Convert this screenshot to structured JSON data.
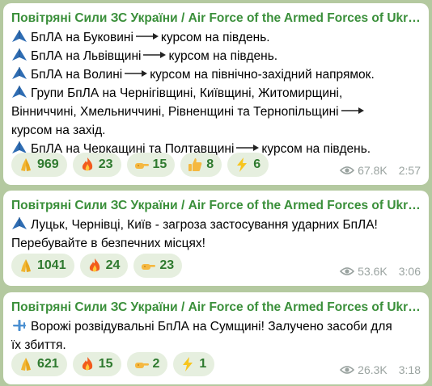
{
  "colors": {
    "sender": "#3a8f3a",
    "reaction_bg": "#e6efdf",
    "reaction_text": "#2f7a2f",
    "meta": "#9aa3a0",
    "chat_bg": "#b4c9a0"
  },
  "messages": [
    {
      "sender": "Повітряні Сили ЗС України / Air Force of the Armed Forces of Ukraine",
      "lines": [
        {
          "icon": "drone-icon",
          "text": "БпЛА на Буковині",
          "arrow": true,
          "text2": "курсом на південь."
        },
        {
          "icon": "drone-icon",
          "text": "БпЛА на Львівщині",
          "arrow": true,
          "text2": "курсом на південь."
        },
        {
          "icon": "drone-icon",
          "text": "БпЛА на Волині",
          "arrow": true,
          "text2": "курсом на північно-західний напрямок."
        },
        {
          "icon": "drone-icon",
          "text": "Групи БпЛА на Чернігівщині, Київщині, Житомирщині,"
        },
        {
          "icon": "",
          "text": "Вінниччині, Хмельниччині, Рівненщині та Тернопільщині",
          "arrow": true
        },
        {
          "icon": "",
          "text": "курсом на захід."
        },
        {
          "icon": "drone-icon",
          "text": "БпЛА на Черкащині та Полтавщині",
          "arrow": true,
          "text2": "курсом на південь."
        }
      ],
      "reactions": [
        {
          "icon": "pray-icon",
          "count": "969"
        },
        {
          "icon": "fire-icon",
          "count": "23"
        },
        {
          "icon": "point-icon",
          "count": "15"
        },
        {
          "icon": "thumbsup-icon",
          "count": "8"
        },
        {
          "icon": "lightning-icon",
          "count": "6"
        }
      ],
      "views": "67.8K",
      "time": "2:57"
    },
    {
      "sender": "Повітряні Сили ЗС України / Air Force of the Armed Forces of Ukraine",
      "lines": [
        {
          "icon": "drone-icon",
          "text": "Луцьк, Чернівці, Київ - загроза застосування ударних БпЛА!"
        },
        {
          "icon": "",
          "text": "Перебувайте в безпечних місцях!"
        }
      ],
      "reactions": [
        {
          "icon": "pray-icon",
          "count": "1041"
        },
        {
          "icon": "fire-icon",
          "count": "24"
        },
        {
          "icon": "point-icon",
          "count": "23"
        }
      ],
      "views": "53.6K",
      "time": "3:06"
    },
    {
      "sender": "Повітряні Сили ЗС України / Air Force of the Armed Forces of Ukraine",
      "lines": [
        {
          "icon": "plane-icon",
          "text": "Ворожі розвідувальні БпЛА на Сумщині! Залучено засоби для"
        },
        {
          "icon": "",
          "text": "їх збиття."
        }
      ],
      "reactions": [
        {
          "icon": "pray-icon",
          "count": "621"
        },
        {
          "icon": "fire-icon",
          "count": "15"
        },
        {
          "icon": "point-icon",
          "count": "2"
        },
        {
          "icon": "lightning-icon",
          "count": "1"
        }
      ],
      "views": "26.3K",
      "time": "3:18"
    }
  ]
}
